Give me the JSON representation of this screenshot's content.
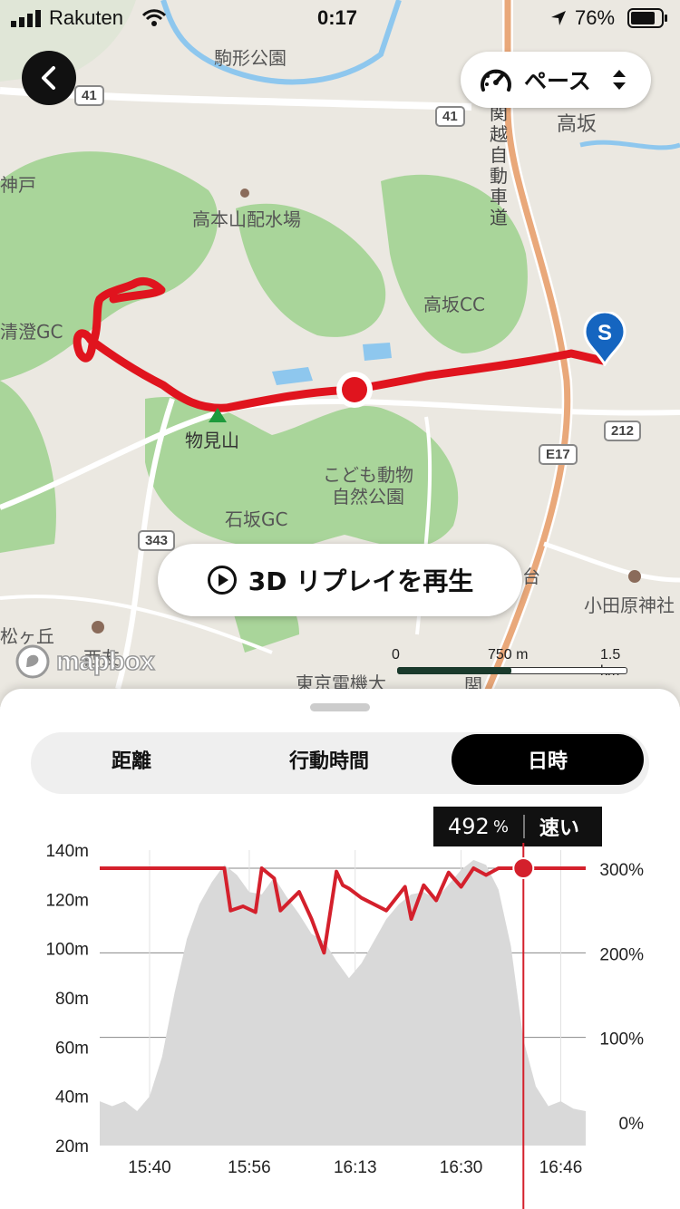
{
  "status_bar": {
    "carrier": "Rakuten",
    "time": "0:17",
    "battery": "76%"
  },
  "map": {
    "labels": {
      "park1": "駒形公園",
      "kobe": "神戸",
      "water": "高本山配水場",
      "takasakacc": "高坂CC",
      "seichogc": "清澄GC",
      "monomiyama": "物見山",
      "zoo1": "こども動物",
      "zoo2": "自然公園",
      "ishizakagc": "石坂GC",
      "takasaka": "高坂",
      "kanetsu": "関越自動車道",
      "odawara": "小田原神社",
      "matsugaoka": "松ヶ丘",
      "nishi": "西友",
      "tdu": "東京電機大",
      "dai": "台",
      "kan": "関"
    },
    "shields": {
      "r41a": "41",
      "r41b": "41",
      "r212": "212",
      "e17": "E17",
      "r343": "343"
    },
    "start_marker": "S",
    "attribution": "mapbox",
    "scale": {
      "s0": "0",
      "s1": "750 m",
      "s2": "1.5 km"
    }
  },
  "pace_button": {
    "label": "ペース"
  },
  "replay_button": {
    "label": "3D リプレイを再生"
  },
  "tabs": [
    {
      "label": "距離",
      "active": false
    },
    {
      "label": "行動時間",
      "active": false
    },
    {
      "label": "日時",
      "active": true
    }
  ],
  "tooltip": {
    "value": "492",
    "unit": "%",
    "status": "速い"
  },
  "chart_data": {
    "type": "area",
    "series": [
      {
        "name": "elevation",
        "axis": "left"
      },
      {
        "name": "pace",
        "axis": "right",
        "color": "#d4202c"
      }
    ],
    "x_ticks": [
      "15:40",
      "15:56",
      "16:13",
      "16:30",
      "16:46"
    ],
    "y_left_ticks": [
      "140m",
      "120m",
      "100m",
      "80m",
      "60m",
      "40m",
      "20m"
    ],
    "y_left_range": [
      20,
      140
    ],
    "y_right_ticks": [
      "300%",
      "200%",
      "100%",
      "0%"
    ],
    "y_right_range": [
      0,
      300
    ],
    "x_range": [
      "15:32",
      "16:50"
    ],
    "elevation": {
      "x": [
        "15:32",
        "15:34",
        "15:36",
        "15:38",
        "15:40",
        "15:42",
        "15:44",
        "15:46",
        "15:48",
        "15:50",
        "15:52",
        "15:54",
        "15:56",
        "15:58",
        "16:00",
        "16:02",
        "16:04",
        "16:06",
        "16:08",
        "16:10",
        "16:12",
        "16:14",
        "16:16",
        "16:18",
        "16:20",
        "16:22",
        "16:24",
        "16:26",
        "16:28",
        "16:30",
        "16:32",
        "16:34",
        "16:36",
        "16:38",
        "16:40",
        "16:42",
        "16:44",
        "16:46",
        "16:48",
        "16:50"
      ],
      "y": [
        38,
        36,
        38,
        34,
        40,
        56,
        82,
        104,
        118,
        127,
        134,
        130,
        123,
        122,
        129,
        121,
        114,
        106,
        103,
        95,
        88,
        94,
        103,
        112,
        118,
        122,
        123,
        120,
        126,
        132,
        136,
        134,
        124,
        101,
        63,
        44,
        36,
        38,
        35,
        34
      ]
    },
    "pace": {
      "x": [
        "15:32",
        "15:45",
        "15:52",
        "15:53",
        "15:55",
        "15:57",
        "15:58",
        "16:00",
        "16:01",
        "16:04",
        "16:06",
        "16:08",
        "16:10",
        "16:11",
        "16:12",
        "16:14",
        "16:18",
        "16:21",
        "16:22",
        "16:24",
        "16:26",
        "16:28",
        "16:30",
        "16:32",
        "16:34",
        "16:36",
        "16:50"
      ],
      "y": [
        300,
        300,
        300,
        250,
        255,
        248,
        300,
        288,
        250,
        272,
        240,
        200,
        296,
        280,
        276,
        265,
        250,
        278,
        240,
        280,
        262,
        295,
        278,
        303,
        292,
        305,
        300
      ]
    },
    "cursor": {
      "x": "16:40",
      "value": "492"
    }
  }
}
